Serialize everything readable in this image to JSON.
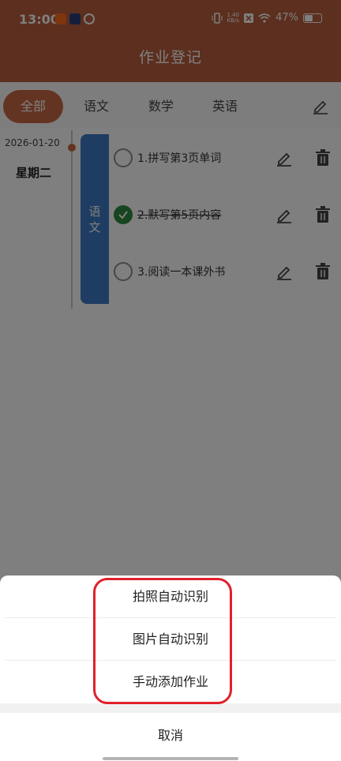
{
  "status_bar": {
    "time": "13:00",
    "net_speed": "1.40",
    "net_unit": "KB/s",
    "battery": "47%",
    "icons": [
      "vibrate-icon",
      "wifi-icon",
      "sim-off-icon",
      "battery-icon"
    ]
  },
  "header": {
    "title": "作业登记"
  },
  "tabs": {
    "items": [
      {
        "label": "全部",
        "active": true
      },
      {
        "label": "语文",
        "active": false
      },
      {
        "label": "数学",
        "active": false
      },
      {
        "label": "英语",
        "active": false
      }
    ],
    "edit_icon": "pencil-icon"
  },
  "entry": {
    "date": "2026-01-20",
    "weekday": "星期二",
    "subject": [
      "语",
      "文"
    ],
    "subject_color": "#3f7ac4",
    "tasks": [
      {
        "text": "1.拼写第3页单词",
        "done": false
      },
      {
        "text": "2.默写第5页内容",
        "done": true
      },
      {
        "text": "3.阅读一本课外书",
        "done": false
      }
    ]
  },
  "sheet": {
    "options": [
      "拍照自动识别",
      "图片自动识别",
      "手动添加作业"
    ],
    "cancel": "取消"
  },
  "colors": {
    "header": "#b85f3e",
    "accent": "#c96945",
    "done": "#2e8b3e",
    "highlight": "#e0202a"
  }
}
